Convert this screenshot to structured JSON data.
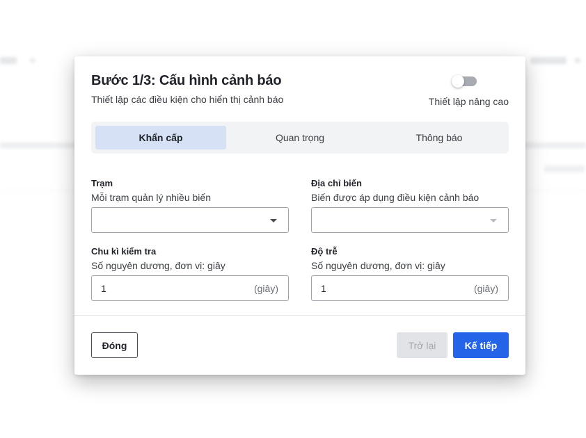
{
  "dialog": {
    "title": "Bước 1/3: Cấu hình cảnh báo",
    "subtitle": "Thiết lập các điều kiện cho hiển thị cảnh báo",
    "advanced_toggle_label": "Thiết lập nâng cao",
    "advanced_toggle_on": false
  },
  "tabs": [
    {
      "label": "Khẩn cấp",
      "active": true
    },
    {
      "label": "Quan trọng",
      "active": false
    },
    {
      "label": "Thông báo",
      "active": false
    }
  ],
  "fields": {
    "station": {
      "label": "Trạm",
      "hint": "Mỗi trạm quản lý nhiều biến",
      "value": "",
      "icon": "chevron-down-icon"
    },
    "variable_address": {
      "label": "Địa chỉ biến",
      "hint": "Biến được áp dụng điều kiện cảnh báo",
      "value": "",
      "icon": "chevron-down-icon"
    },
    "check_interval": {
      "label": "Chu kì kiểm tra",
      "hint": "Số nguyên dương, đơn vị: giây",
      "value": "1",
      "unit": "(giây)"
    },
    "delay": {
      "label": "Độ trễ",
      "hint": "Số nguyên dương, đơn vị: giây",
      "value": "1",
      "unit": "(giây)"
    }
  },
  "footer": {
    "close_label": "Đóng",
    "back_label": "Trở lại",
    "next_label": "Kế tiếp"
  },
  "colors": {
    "primary": "#2364e8",
    "active_tab_bg": "#d6e1f5",
    "disabled_bg": "#e1e3e6"
  }
}
